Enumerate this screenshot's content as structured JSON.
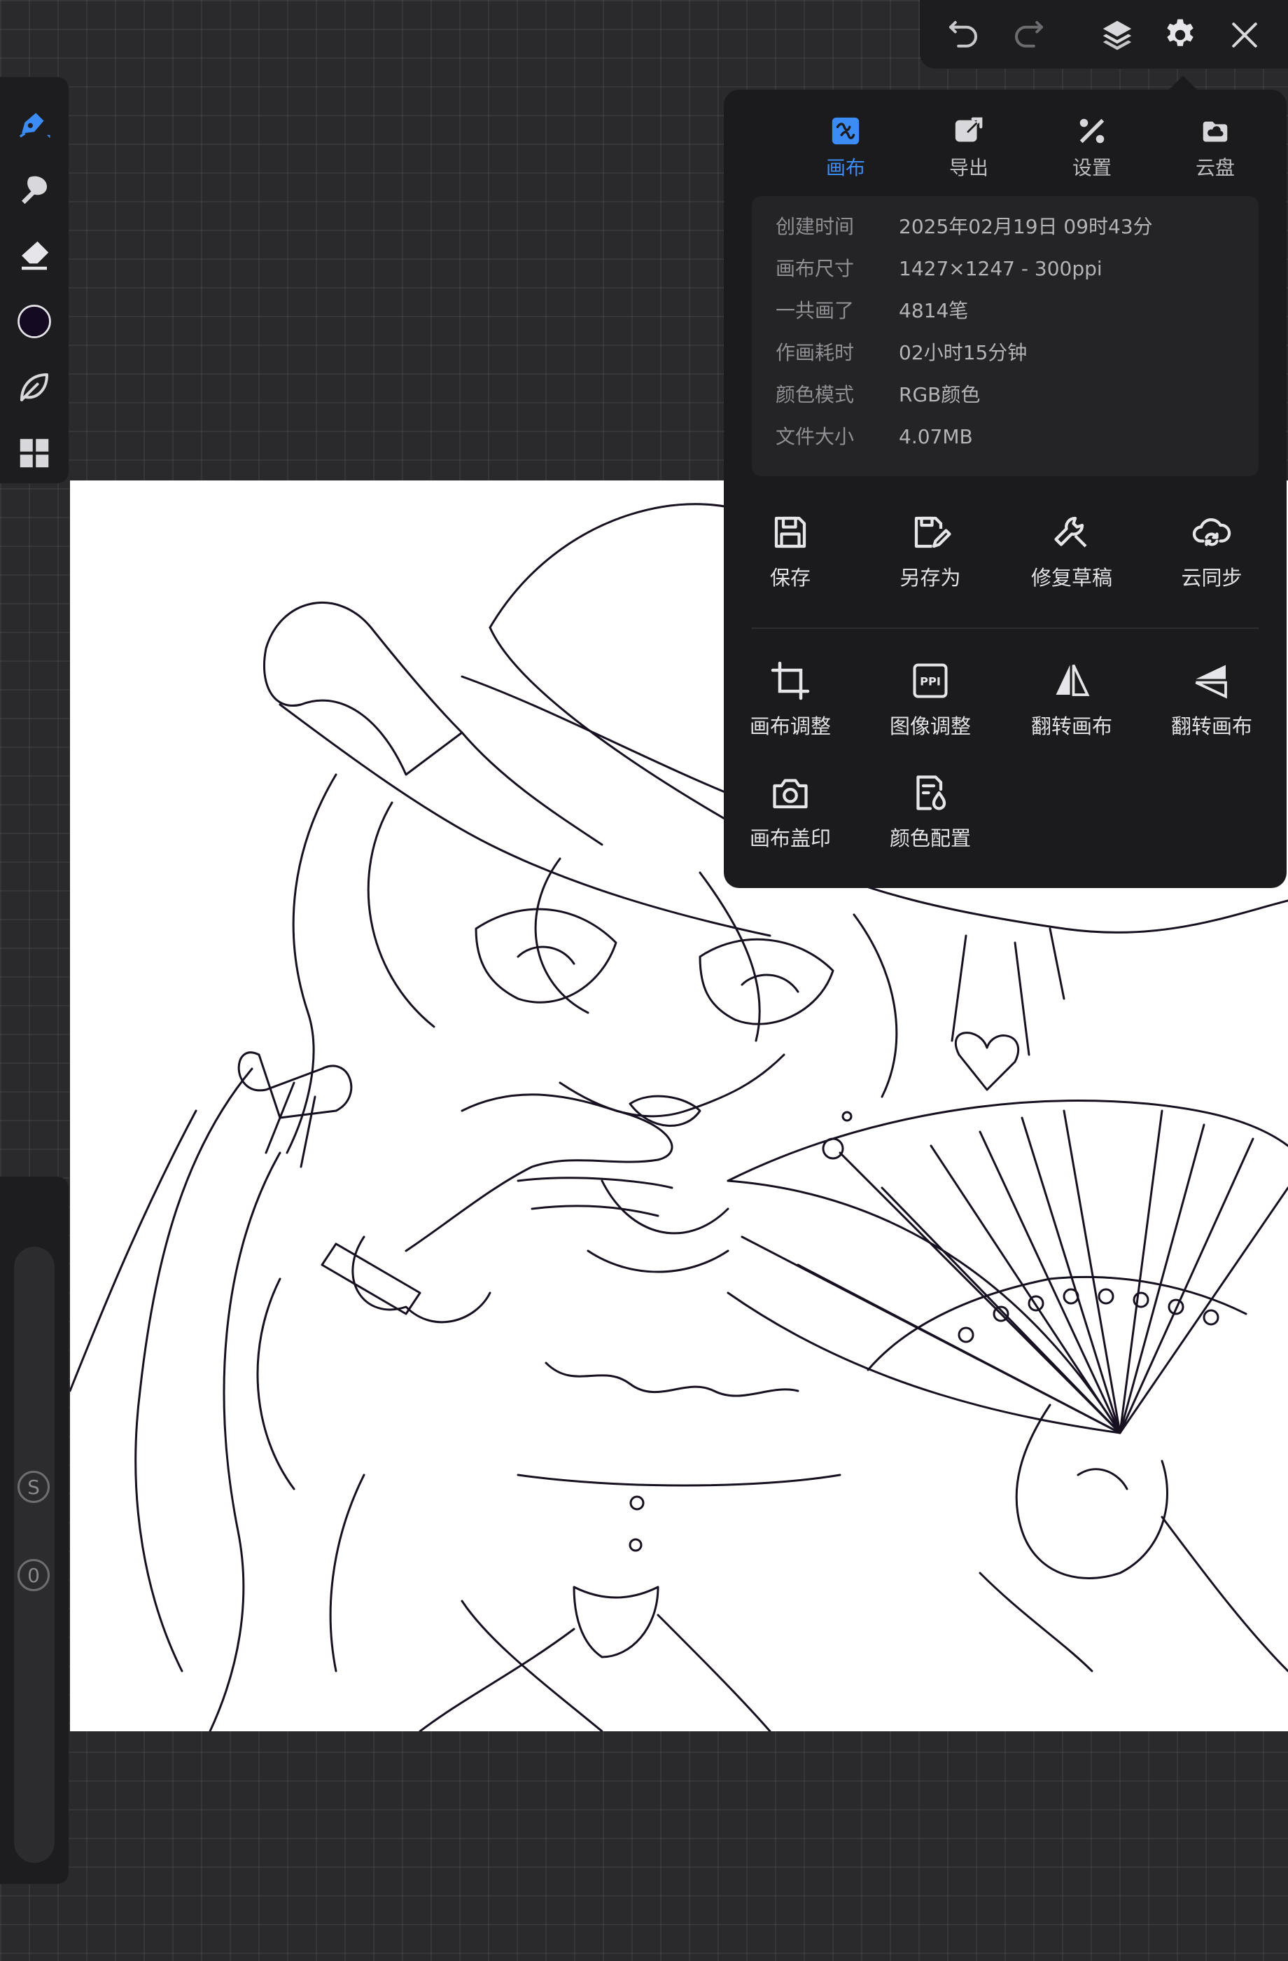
{
  "panel": {
    "tabs": [
      {
        "label": "画布",
        "icon": "canvas-tab-icon",
        "active": true
      },
      {
        "label": "导出",
        "icon": "export-icon",
        "active": false
      },
      {
        "label": "设置",
        "icon": "settings-tools-icon",
        "active": false
      },
      {
        "label": "云盘",
        "icon": "cloud-drive-icon",
        "active": false
      }
    ],
    "info": [
      {
        "label": "创建时间",
        "value": "2025年02月19日 09时43分"
      },
      {
        "label": "画布尺寸",
        "value": "1427×1247 - 300ppi"
      },
      {
        "label": "一共画了",
        "value": "4814笔"
      },
      {
        "label": "作画耗时",
        "value": "02小时15分钟"
      },
      {
        "label": "颜色模式",
        "value": "RGB颜色"
      },
      {
        "label": "文件大小",
        "value": "4.07MB"
      }
    ],
    "actions_row1": [
      {
        "label": "保存",
        "icon": "save-icon"
      },
      {
        "label": "另存为",
        "icon": "save-as-icon"
      },
      {
        "label": "修复草稿",
        "icon": "wrench-icon"
      },
      {
        "label": "云同步",
        "icon": "cloud-sync-icon"
      }
    ],
    "actions_row2": [
      {
        "label": "画布调整",
        "icon": "crop-icon"
      },
      {
        "label": "图像调整",
        "icon": "ppi-icon",
        "icon_text": "PPI"
      },
      {
        "label": "翻转画布",
        "icon": "flip-horizontal-icon"
      },
      {
        "label": "翻转画布",
        "icon": "flip-vertical-icon"
      }
    ],
    "actions_row3": [
      {
        "label": "画布盖印",
        "icon": "camera-stamp-icon"
      },
      {
        "label": "颜色配置",
        "icon": "color-profile-icon"
      }
    ]
  },
  "top_bar": {
    "icons": [
      "undo-icon",
      "redo-icon",
      "layers-icon",
      "gear-icon",
      "close-icon"
    ]
  },
  "left_toolbar": {
    "icons": [
      "pen-icon",
      "smudge-icon",
      "eraser-icon",
      "color-swatch",
      "leaf-brush-icon",
      "grid-menu-icon"
    ],
    "current_color": "#140a22",
    "active_color": "#3b8cf5"
  },
  "left_rail": {
    "s_label": "S",
    "zero_label": "0"
  }
}
